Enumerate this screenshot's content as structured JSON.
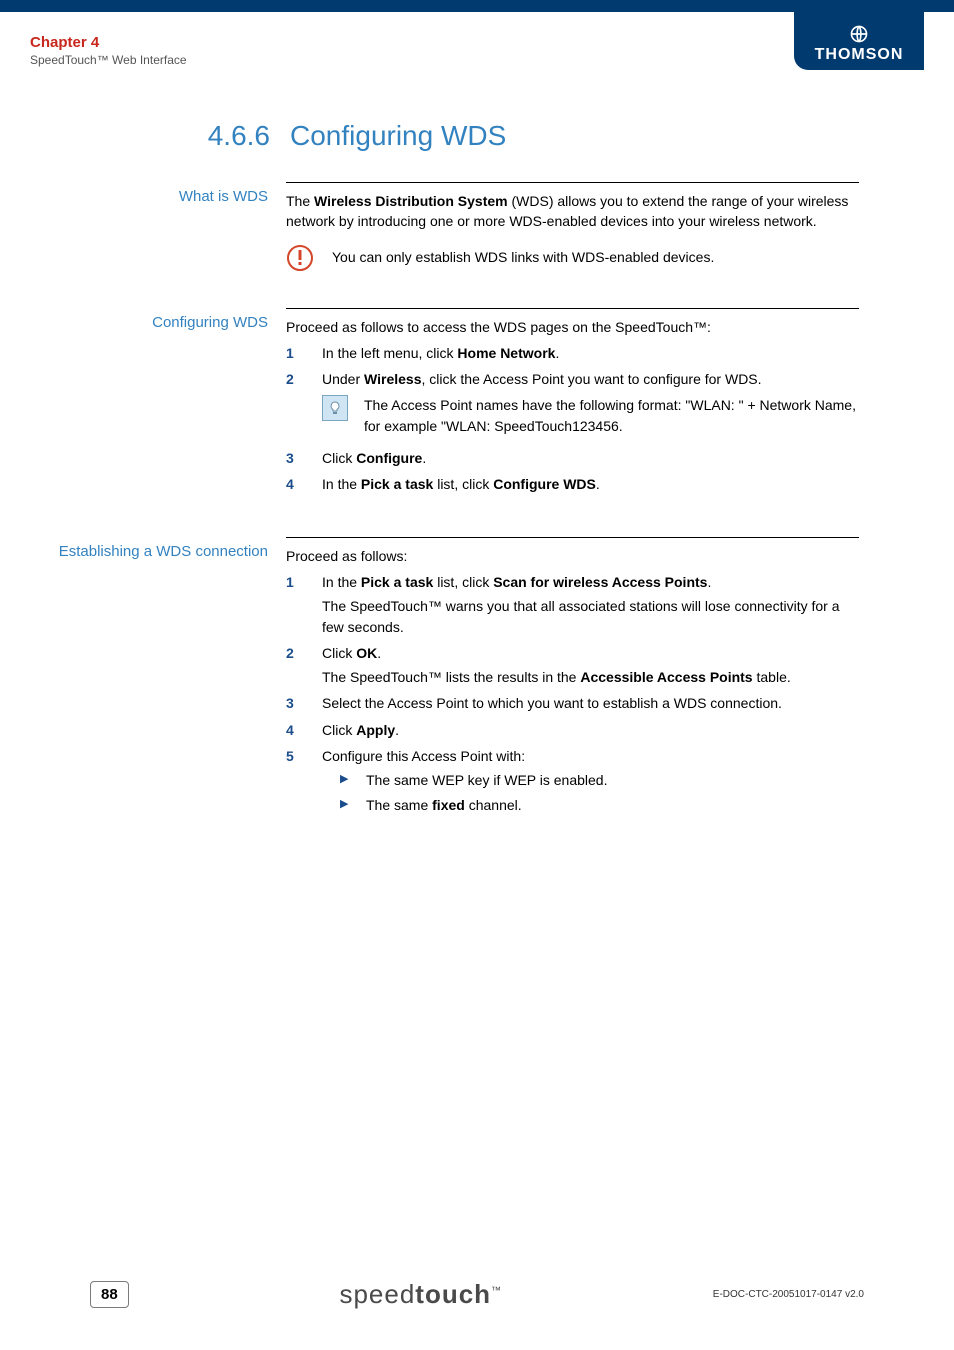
{
  "header": {
    "chapter": "Chapter 4",
    "subtitle": "SpeedTouch™ Web Interface",
    "brand": "THOMSON"
  },
  "title": {
    "number": "4.6.6",
    "text": "Configuring WDS"
  },
  "sections": {
    "what_is_wds": {
      "label": "What is WDS",
      "para_pre": "The ",
      "para_bold": "Wireless Distribution System",
      "para_post": " (WDS) allows you to extend the range of your wireless network by introducing one or more WDS-enabled devices into your wireless network.",
      "warn": "You can only establish WDS links with WDS-enabled devices."
    },
    "configuring": {
      "label": "Configuring WDS",
      "intro": "Proceed as follows to access the WDS pages on the SpeedTouch™:",
      "step1_pre": "In the left menu, click ",
      "step1_bold": "Home Network",
      "step1_post": ".",
      "step2_pre": "Under ",
      "step2_bold": "Wireless",
      "step2_post": ", click the Access Point you want to configure for WDS.",
      "tip": "The Access Point names have the following format: \"WLAN: \" + Network Name, for example \"WLAN: SpeedTouch123456.",
      "step3_pre": "Click ",
      "step3_bold": "Configure",
      "step3_post": ".",
      "step4_pre": "In the ",
      "step4_bold1": "Pick a task",
      "step4_mid": " list, click ",
      "step4_bold2": "Configure WDS",
      "step4_post": "."
    },
    "establishing": {
      "label": "Establishing a WDS connection",
      "intro": "Proceed as follows:",
      "step1_pre": "In the ",
      "step1_bold1": "Pick a task",
      "step1_mid": " list, click ",
      "step1_bold2": "Scan for wireless Access Points",
      "step1_post": ".",
      "step1_sub": "The SpeedTouch™ warns you that all associated stations will lose connectivity for a few seconds.",
      "step2_pre": "Click ",
      "step2_bold": "OK",
      "step2_post": ".",
      "step2_sub_pre": "The SpeedTouch™ lists the results in the ",
      "step2_sub_bold": "Accessible Access Points",
      "step2_sub_post": " table.",
      "step3": "Select the Access Point to which you want to establish a WDS connection.",
      "step4_pre": "Click ",
      "step4_bold": "Apply",
      "step4_post": ".",
      "step5": "Configure this Access Point with:",
      "bullet1": "The same WEP key if WEP is enabled.",
      "bullet2_pre": "The same ",
      "bullet2_bold": "fixed",
      "bullet2_post": " channel."
    }
  },
  "footer": {
    "page": "88",
    "logo_thin": "speed",
    "logo_bold": "touch",
    "tm": "™",
    "docid": "E-DOC-CTC-20051017-0147 v2.0"
  }
}
